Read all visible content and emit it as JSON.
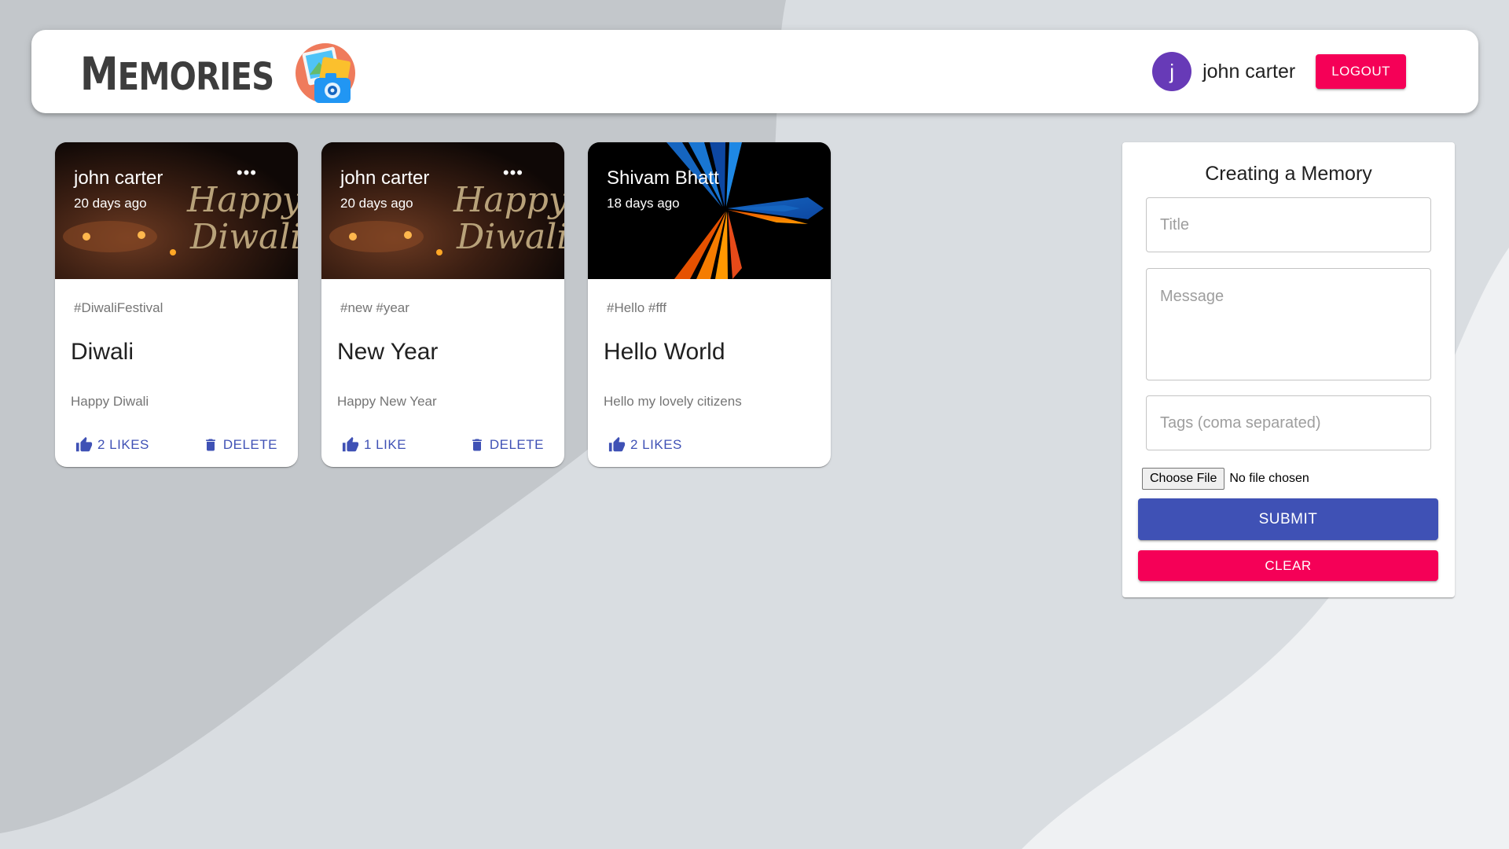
{
  "header": {
    "brand": "Memories",
    "user": {
      "initial": "j",
      "name": "john carter"
    },
    "logout_label": "LOGOUT"
  },
  "posts": [
    {
      "creator": "john carter",
      "time": "20 days ago",
      "more": "•••",
      "image_text": [
        "Happy",
        "Diwali"
      ],
      "tags": "#DiwaliFestival",
      "title": "Diwali",
      "message": "Happy Diwali",
      "likes_label": "2 LIKES",
      "delete_label": "DELETE"
    },
    {
      "creator": "john carter",
      "time": "20 days ago",
      "more": "•••",
      "image_text": [
        "Happy",
        "Diwali"
      ],
      "tags": "#new #year",
      "title": "New Year",
      "message": "Happy New Year",
      "likes_label": "1 LIKE",
      "delete_label": "DELETE"
    },
    {
      "creator": "Shivam Bhatt",
      "time": "18 days ago",
      "tags": "#Hello #fff",
      "title": "Hello World",
      "message": "Hello my lovely citizens",
      "likes_label": "2 LIKES"
    }
  ],
  "form": {
    "heading": "Creating a Memory",
    "title_placeholder": "Title",
    "message_placeholder": "Message",
    "tags_placeholder": "Tags (coma separated)",
    "choose_file_label": "Choose File",
    "no_file_text": "No file chosen",
    "submit_label": "SUBMIT",
    "clear_label": "CLEAR"
  },
  "colors": {
    "primary": "#3f51b5",
    "secondary": "#f50057",
    "avatar": "#673ab7",
    "background": "#d9dde1"
  }
}
